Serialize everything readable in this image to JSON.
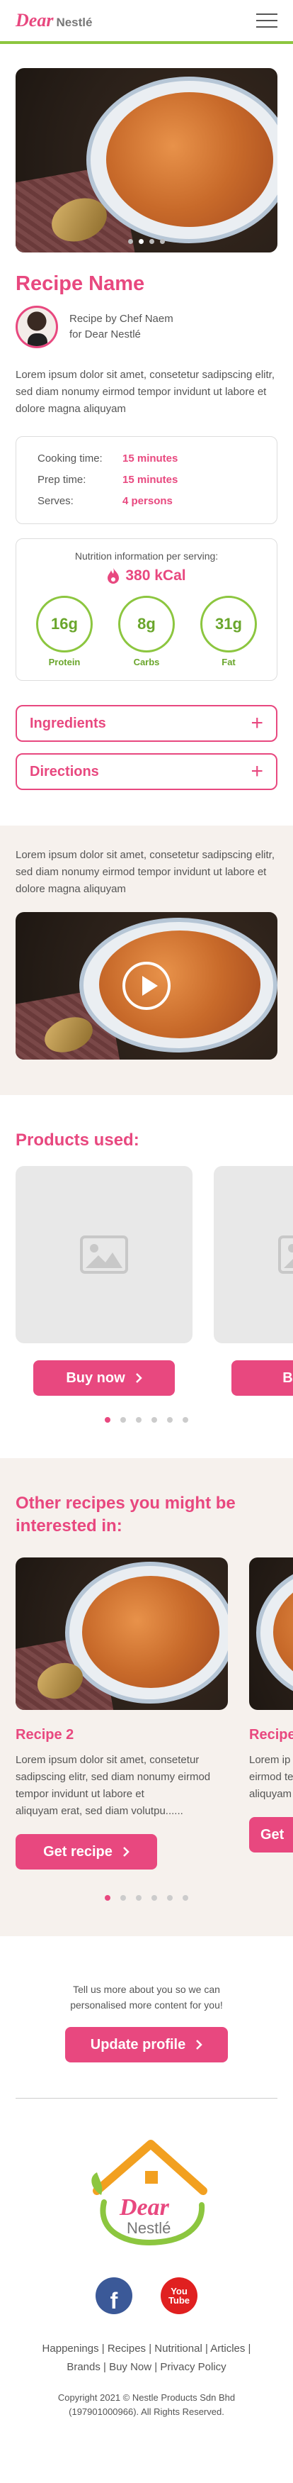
{
  "header": {
    "logo_dear": "Dear",
    "logo_nestle": "Nestlé"
  },
  "recipe": {
    "title": "Recipe Name",
    "chef_line1": "Recipe by Chef Naem",
    "chef_line2": "for Dear Nestlé",
    "description": "Lorem ipsum dolor sit amet, consetetur sadipscing elitr, sed diam nonumy eirmod tempor invidunt ut labore et dolore magna aliquyam",
    "times": [
      {
        "label": "Cooking time:",
        "value": "15 minutes"
      },
      {
        "label": "Prep time:",
        "value": "15 minutes"
      },
      {
        "label": "Serves:",
        "value": "4 persons"
      }
    ],
    "nutrition": {
      "title": "Nutrition information per serving:",
      "kcal": "380 kCal",
      "items": [
        {
          "value": "16g",
          "label": "Protein"
        },
        {
          "value": "8g",
          "label": "Carbs"
        },
        {
          "value": "31g",
          "label": "Fat"
        }
      ]
    },
    "accordions": [
      {
        "label": "Ingredients"
      },
      {
        "label": "Directions"
      }
    ],
    "plus": "+"
  },
  "video_section": {
    "text": "Lorem ipsum dolor sit amet, consetetur sadipscing elitr, sed diam nonumy eirmod tempor invidunt ut labore et dolore magna aliquyam"
  },
  "products": {
    "title": "Products used:",
    "buy_label": "Buy now",
    "partial_label": "Buy n"
  },
  "other": {
    "title": "Other recipes you might be interested in:",
    "recipe_title": "Recipe 2",
    "recipe_desc": "Lorem ipsum dolor sit amet, consetetur sadipscing elitr, sed diam nonumy eirmod tempor invidunt ut labore et",
    "recipe_desc_faded": "aliquyam erat, sed diam volutpu......",
    "partial_title": "Recipe",
    "partial_desc": "Lorem ip eirmod te aliquyam",
    "get_label": "Get recipe",
    "partial_btn": "Get"
  },
  "personalise": {
    "text": "Tell us more about you so we can personalised more content for you!",
    "button": "Update profile"
  },
  "footer": {
    "links_line1": "Happenings | Recipes | Nutritional | Articles |",
    "links_line2": "Brands | Buy Now | Privacy Policy",
    "copyright1": "Copyright 2021 © Nestle Products Sdn Bhd",
    "copyright2": "(197901000966). All Rights Reserved.",
    "youtube_you": "You",
    "youtube_tube": "Tube",
    "facebook": "f"
  },
  "colors": {
    "accent": "#e8487f",
    "green": "#8cc63f",
    "beige": "#f6f1ed"
  }
}
